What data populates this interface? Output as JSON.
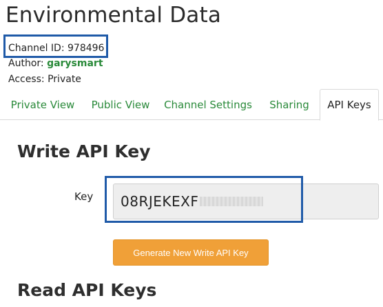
{
  "page": {
    "title": "Environmental Data"
  },
  "channel": {
    "id_label": "Channel ID:",
    "id_value": "978496",
    "author_label": "Author:",
    "author_value": "garysmart",
    "access_label": "Access:",
    "access_value": "Private"
  },
  "tabs": [
    {
      "label": "Private View"
    },
    {
      "label": "Public View"
    },
    {
      "label": "Channel Settings"
    },
    {
      "label": "Sharing"
    },
    {
      "label": "API Keys"
    }
  ],
  "write_section": {
    "title": "Write API Key",
    "key_label": "Key",
    "key_value": "08RJEKEXF",
    "generate_label": "Generate New Write API Key"
  },
  "read_section": {
    "title": "Read API Keys"
  },
  "colors": {
    "link_green": "#2a8a3a",
    "button_orange": "#f0a038",
    "highlight_blue": "#1f5aa8"
  }
}
